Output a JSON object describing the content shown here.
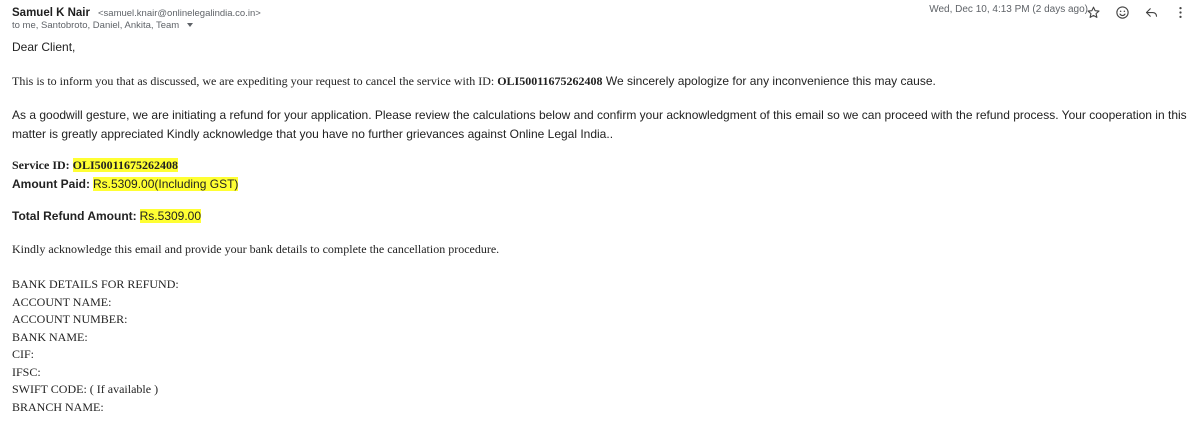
{
  "header": {
    "sender_name": "Samuel K Nair",
    "sender_email": "<samuel.knair@onlinelegalindia.co.in>",
    "recipients": "to me, Santobroto, Daniel, Ankita, Team",
    "date": "Wed, Dec 10, 4:13 PM (2 days ago)",
    "icons": [
      "star-icon",
      "emoji-icon",
      "reply-icon",
      "more-icon"
    ]
  },
  "email": {
    "greeting": "Dear Client,",
    "intro_prefix": "This is to inform you that as discussed, we are expediting your request to cancel the service with ID: ",
    "intro_id": "OLI50011675262408",
    "intro_suffix": " We sincerely apologize for any inconvenience this may cause.",
    "goodwill": "As a goodwill gesture, we are initiating a refund for your application. Please review the calculations below and confirm your acknowledgment of this email so we can proceed with the refund process. Your cooperation in this matter is greatly appreciated Kindly acknowledge that you have no further grievances against Online Legal India..",
    "service_id_label": "Service ID:",
    "service_id_value": "OLI50011675262408",
    "amount_paid_label": "Amount Paid:",
    "amount_paid_value": "Rs.5309.00(Including GST)",
    "total_refund_label": "Total Refund Amount:",
    "total_refund_value": "Rs.5309.00",
    "acknowledge": "Kindly acknowledge this email and provide your bank details to complete the cancellation procedure.",
    "bank_lines": [
      "BANK DETAILS FOR REFUND:",
      "ACCOUNT NAME:",
      "ACCOUNT NUMBER:",
      "BANK NAME:",
      "CIF:",
      "IFSC:",
      "SWIFT CODE: ( If available )",
      "BRANCH NAME:"
    ]
  },
  "colors": {
    "highlight": "#ffff33",
    "text": "#222222",
    "meta": "#5f6368"
  }
}
